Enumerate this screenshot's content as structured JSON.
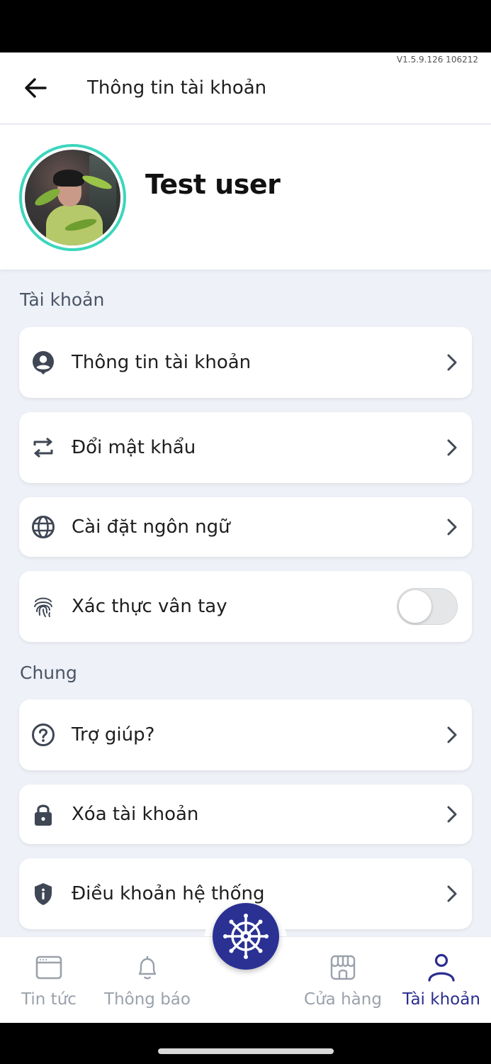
{
  "app_version": "V1.5.9.126 106212",
  "header": {
    "title": "Thông tin tài khoản",
    "back_icon": "arrow-left-icon"
  },
  "profile": {
    "name": "Test user",
    "avatar_ring_color": "#3cd6bd"
  },
  "sections": [
    {
      "label": "Tài khoản",
      "items": [
        {
          "label": "Thông tin tài khoản",
          "icon": "account-circle-icon",
          "control": "chevron"
        },
        {
          "label": "Đổi mật khẩu",
          "icon": "swap-arrows-icon",
          "control": "chevron"
        },
        {
          "label": "Cài đặt ngôn ngữ",
          "icon": "globe-icon",
          "control": "chevron"
        },
        {
          "label": "Xác thực vân tay",
          "icon": "fingerprint-icon",
          "control": "toggle",
          "toggle_on": false
        }
      ]
    },
    {
      "label": "Chung",
      "items": [
        {
          "label": "Trợ giúp?",
          "icon": "help-circle-icon",
          "control": "chevron"
        },
        {
          "label": "Xóa tài khoản",
          "icon": "lock-icon",
          "control": "chevron"
        },
        {
          "label": "Điều khoản hệ thống",
          "icon": "shield-info-icon",
          "control": "chevron"
        }
      ]
    }
  ],
  "bottom_nav": {
    "items": [
      {
        "label": "Tin tức",
        "icon": "browser-window-icon",
        "active": false
      },
      {
        "label": "Thông báo",
        "icon": "bell-icon",
        "active": false
      },
      {
        "label": "Cửa hàng",
        "icon": "storefront-icon",
        "active": false
      },
      {
        "label": "Tài khoản",
        "icon": "person-icon",
        "active": true
      }
    ],
    "center_icon": "ship-wheel-icon"
  },
  "colors": {
    "accent": "#2b3193",
    "icon_gray": "#3f4654",
    "muted": "#9aa1ab"
  }
}
